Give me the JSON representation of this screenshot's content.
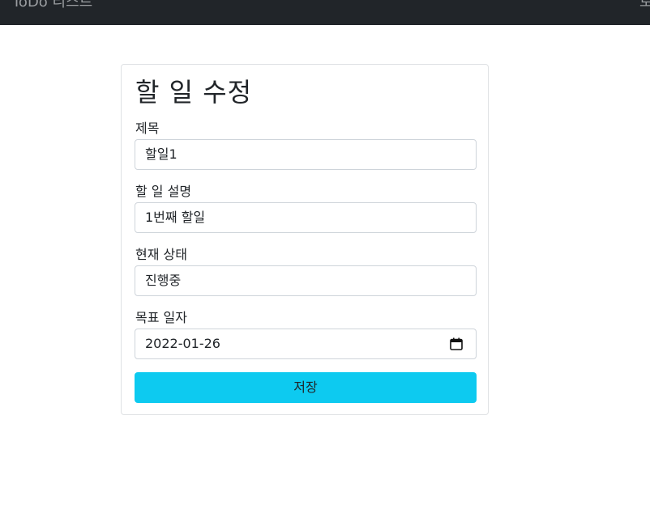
{
  "navbar": {
    "brand": "ToDo 리스트",
    "right_text": "로"
  },
  "form": {
    "title": "할 일 수정",
    "fields": [
      {
        "label": "제목",
        "value": "할일1"
      },
      {
        "label": "할 일 설명",
        "value": "1번째 할일"
      },
      {
        "label": "현재 상태",
        "value": "진행중"
      },
      {
        "label": "목표 일자",
        "value": "2022-01-26"
      }
    ],
    "save_label": "저장"
  },
  "colors": {
    "navbar_bg": "#212529",
    "button_bg": "#0dcaf0",
    "card_border": "#dfe1e4"
  },
  "icons": {
    "date_picker": "calendar-icon"
  }
}
